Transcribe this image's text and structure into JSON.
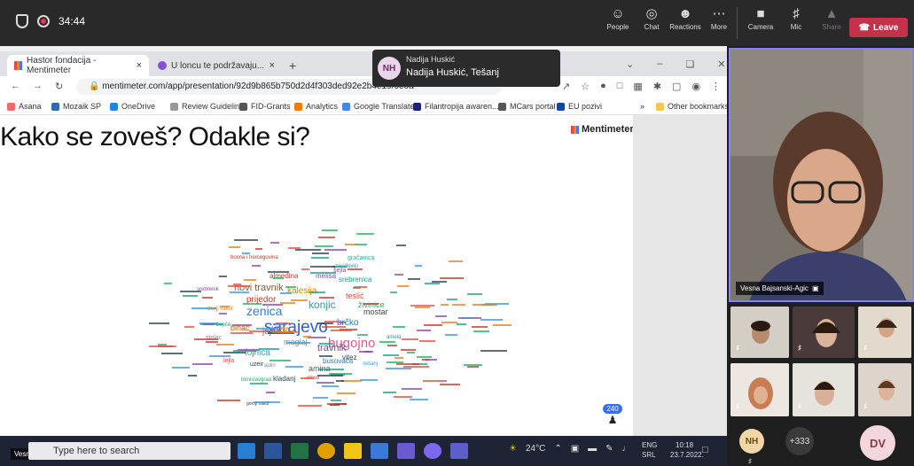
{
  "teams_bar": {
    "timer": "34:44",
    "tools": [
      {
        "label": "People",
        "icon": "people-icon"
      },
      {
        "label": "Chat",
        "icon": "chat-icon"
      },
      {
        "label": "Reactions",
        "icon": "reactions-icon"
      },
      {
        "label": "More",
        "icon": "more-icon"
      }
    ],
    "media": [
      {
        "label": "Camera",
        "icon": "camera-off-icon"
      },
      {
        "label": "Mic",
        "icon": "mic-off-icon"
      },
      {
        "label": "Share",
        "icon": "share-icon"
      }
    ],
    "leave_label": "Leave"
  },
  "tooltip": {
    "initials": "NH",
    "name": "Nadija Huskić",
    "location": "Nadija Huskić, Tešanj"
  },
  "browser": {
    "tabs": [
      {
        "label": "Hastor fondacija - Mentimeter",
        "active": true
      },
      {
        "label": "U loncu te podržavaju...",
        "active": false
      }
    ],
    "url": "mentimeter.com/app/presentation/92d9b865b750d2d4f303ded92e2b4e19/6e0a",
    "bookmarks": [
      "Asana",
      "Mozaik SP",
      "OneDrive",
      "Review Guidelines",
      "FID-Grants",
      "Analytics",
      "Google Translate",
      "Filantropija awaren...",
      "MCars portal",
      "EU pozivi"
    ],
    "other_bookmarks": "Other bookmarks"
  },
  "slide": {
    "title": "Kako se zoveš? Odakle si?",
    "brand": "Mentimeter",
    "response_count": "240",
    "word_cloud": [
      {
        "w": "sarajevo",
        "c": "#2f5bd3",
        "s": 19
      },
      {
        "w": "bugojno",
        "c": "#e05b8a",
        "s": 15
      },
      {
        "w": "zenica",
        "c": "#3a7bd5",
        "s": 14
      },
      {
        "w": "konjic",
        "c": "#2aa198",
        "s": 12
      },
      {
        "w": "novi travnik",
        "c": "#8a5a2b",
        "s": 11
      },
      {
        "w": "travnik",
        "c": "#6a4c93",
        "s": 11
      },
      {
        "w": "kalesija",
        "c": "#d08a00",
        "s": 10
      },
      {
        "w": "prijedor",
        "c": "#c0392b",
        "s": 10
      },
      {
        "w": "tuzla",
        "c": "#c07a2a",
        "s": 10
      },
      {
        "w": "brčko",
        "c": "#1f77b4",
        "s": 10
      },
      {
        "w": "fojnica",
        "c": "#3498db",
        "s": 10
      },
      {
        "w": "mostar",
        "c": "#444",
        "s": 9
      },
      {
        "w": "teslić",
        "c": "#e74c3c",
        "s": 9
      },
      {
        "w": "živinice",
        "c": "#27ae60",
        "s": 9
      },
      {
        "w": "srebrenica",
        "c": "#16a085",
        "s": 8
      },
      {
        "w": "melisa",
        "c": "#8e44ad",
        "s": 8
      },
      {
        "w": "almedina",
        "c": "#c0392b",
        "s": 8
      },
      {
        "w": "amina",
        "c": "#555",
        "s": 9
      },
      {
        "w": "busovača",
        "c": "#2980b9",
        "s": 8
      },
      {
        "w": "vitez",
        "c": "#2c3e50",
        "s": 8
      },
      {
        "w": "jajce",
        "c": "#9b59b6",
        "s": 10
      },
      {
        "w": "maglaj",
        "c": "#7f8c8d",
        "s": 9
      },
      {
        "w": "bihać",
        "c": "#d35400",
        "s": 9
      },
      {
        "w": "kladanj",
        "c": "#34495e",
        "s": 8
      },
      {
        "w": "gračanica",
        "c": "#1abc9c",
        "s": 7
      },
      {
        "w": "šejla",
        "c": "#8e44ad",
        "s": 7
      },
      {
        "w": "stolac",
        "c": "#7f8c8d",
        "s": 7
      },
      {
        "w": "uzeir",
        "c": "#2c3e50",
        "s": 7
      },
      {
        "w": "lejla",
        "c": "#e74c3c",
        "s": 7
      },
      {
        "w": "tomislavgrad",
        "c": "#27ae60",
        "s": 6
      },
      {
        "w": "olovo",
        "c": "#c0392b",
        "s": 6
      },
      {
        "w": "amela",
        "c": "#16a085",
        "s": 6
      },
      {
        "w": "tešanj",
        "c": "#3498db",
        "s": 6
      },
      {
        "w": "donji vakuf",
        "c": "#e67e22",
        "s": 6
      },
      {
        "w": "bosna i hercegovina",
        "c": "#c0392b",
        "s": 6
      },
      {
        "w": "zavidovići",
        "c": "#2980b9",
        "s": 6
      },
      {
        "w": "ajdin",
        "c": "#7f8c8d",
        "s": 6
      },
      {
        "w": "gornji vakuf",
        "c": "#2c3e50",
        "s": 5
      },
      {
        "w": "srebrenik",
        "c": "#8e44ad",
        "s": 6
      },
      {
        "w": "žepče",
        "c": "#16a085",
        "s": 6
      }
    ]
  },
  "taskbar": {
    "search_placeholder": "Type here to search",
    "weather": "24°C",
    "lang_top": "ENG",
    "lang_bottom": "SRL",
    "time": "10:18",
    "date": "23.7.2022.",
    "caption": "Vesna Bajsanski-Agic"
  },
  "right_panel": {
    "main_name": "Vesna Bajsanski-Agic",
    "avatars": [
      {
        "initials": "NH",
        "bg": "#f1d7a6",
        "fg": "#6b4a10"
      },
      {
        "initials": "+333",
        "bg": "#3a3a3a",
        "fg": "#ddd"
      },
      {
        "initials": "DV",
        "bg": "#f3d7dc",
        "fg": "#8a3a4a"
      }
    ]
  }
}
